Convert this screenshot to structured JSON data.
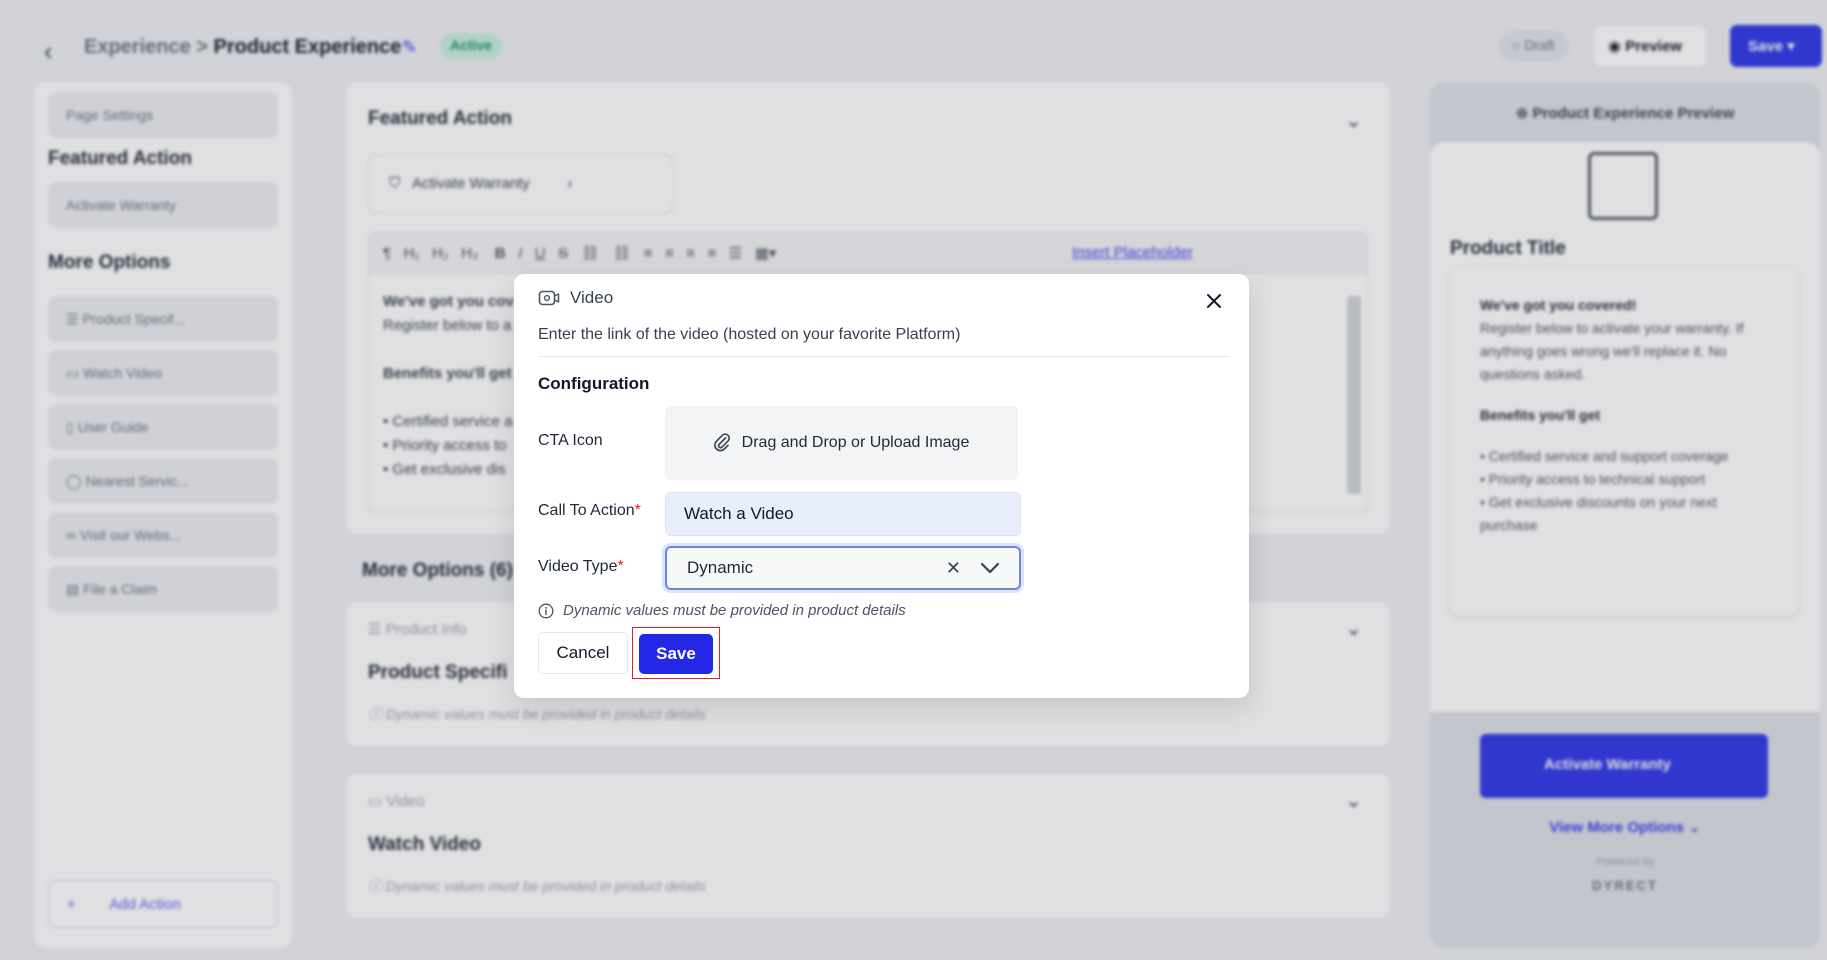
{
  "header": {
    "back_icon": "chevron-left-icon",
    "breadcrumb_parent": "Experience",
    "breadcrumb_sep": ">",
    "breadcrumb_current": "Product Experience",
    "status_badge": "Active",
    "draft_label": "Draft",
    "preview_label": "Preview",
    "save_label": "Save"
  },
  "sidebar": {
    "page_settings": "Page Settings",
    "featured_heading": "Featured Action",
    "featured_item": "Activate Warranty",
    "more_heading": "More Options",
    "items": [
      {
        "label": "Product Specif...",
        "icon": "list-icon"
      },
      {
        "label": "Watch Video",
        "icon": "video-icon"
      },
      {
        "label": "User Guide",
        "icon": "book-icon"
      },
      {
        "label": "Nearest Servic...",
        "icon": "location-icon"
      },
      {
        "label": "Visit our Webs...",
        "icon": "link-icon"
      },
      {
        "label": "File a Claim",
        "icon": "clipboard-icon"
      }
    ],
    "add_action": "Add Action"
  },
  "main": {
    "featured_title": "Featured Action",
    "featured_action_label": "Activate Warranty",
    "insert_placeholder": "Insert Placeholder",
    "editor_lines": [
      "We've got you cov",
      "Register below to a",
      "",
      "Benefits you'll get",
      "",
      "• Certified service a",
      "• Priority access to",
      "• Get exclusive dis"
    ],
    "more_options_title": "More Options (6)",
    "product_info_label": "Product Info",
    "product_spec_title": "Product Specifi",
    "dynamic_note": "Dynamic values must be provided in product details",
    "video_label": "Video",
    "watch_video_title": "Watch Video",
    "dynamic_note_2": "Dynamic values must be provided in product details"
  },
  "preview_panel": {
    "title": "Product Experience Preview",
    "product_title": "Product Title",
    "card_heading": "We've got you covered!",
    "card_text": "Register below to activate your warranty. If anything goes wrong we'll replace it. No questions asked.",
    "benefits_heading": "Benefits you'll get",
    "benefits": [
      "• Certified service and support coverage",
      "• Priority access to technical support",
      "• Get exclusive discounts on your next purchase"
    ],
    "cta_label": "Activate Warranty",
    "view_more": "View More Options",
    "powered_by": "Powered by",
    "brand": "DYRECT"
  },
  "modal": {
    "title": "Video",
    "title_icon": "video-camera-icon",
    "description": "Enter the link of the video (hosted on your favorite Platform)",
    "section": "Configuration",
    "cta_icon_label": "CTA Icon",
    "upload_label": "Drag and Drop or Upload Image",
    "upload_icon": "paperclip-icon",
    "cta_label": "Call To Action",
    "cta_value": "Watch a Video",
    "video_type_label": "Video Type",
    "video_type_value": "Dynamic",
    "required_mark": "*",
    "hint": "Dynamic values must be provided in product details",
    "cancel_label": "Cancel",
    "save_label": "Save"
  },
  "colors": {
    "primary": "#2427e6",
    "highlight": "#e11d2a",
    "required": "#dc2626"
  }
}
